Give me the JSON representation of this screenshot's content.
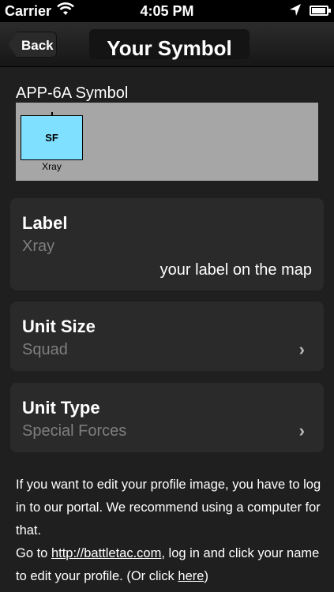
{
  "status_bar": {
    "carrier": "Carrier",
    "time": "4:05 PM",
    "battery_level": 0.92,
    "icons": [
      "wifi-icon",
      "location-arrow-icon",
      "battery-icon"
    ]
  },
  "nav": {
    "back_label": "Back",
    "title": "Your Symbol"
  },
  "symbol": {
    "section_label": "APP-6A Symbol",
    "code": "SF",
    "caption": "Xray",
    "fill_color": "#80e0ff",
    "background_color": "#a6a6a6"
  },
  "label_card": {
    "title": "Label",
    "value": "Xray",
    "hint": "your label on the map"
  },
  "unit_size": {
    "title": "Unit Size",
    "value": "Squad"
  },
  "unit_type": {
    "title": "Unit Type",
    "value": "Special Forces"
  },
  "footer": {
    "line1": "If you want to edit your profile image, you have to log in to our portal. We recommend using a computer for that.",
    "goto_prefix": "Go to ",
    "portal_link": "http://battletac.com",
    "goto_middle": ", log in and click your name to edit your profile. (Or click ",
    "here_link": "here",
    "goto_suffix": ")"
  }
}
